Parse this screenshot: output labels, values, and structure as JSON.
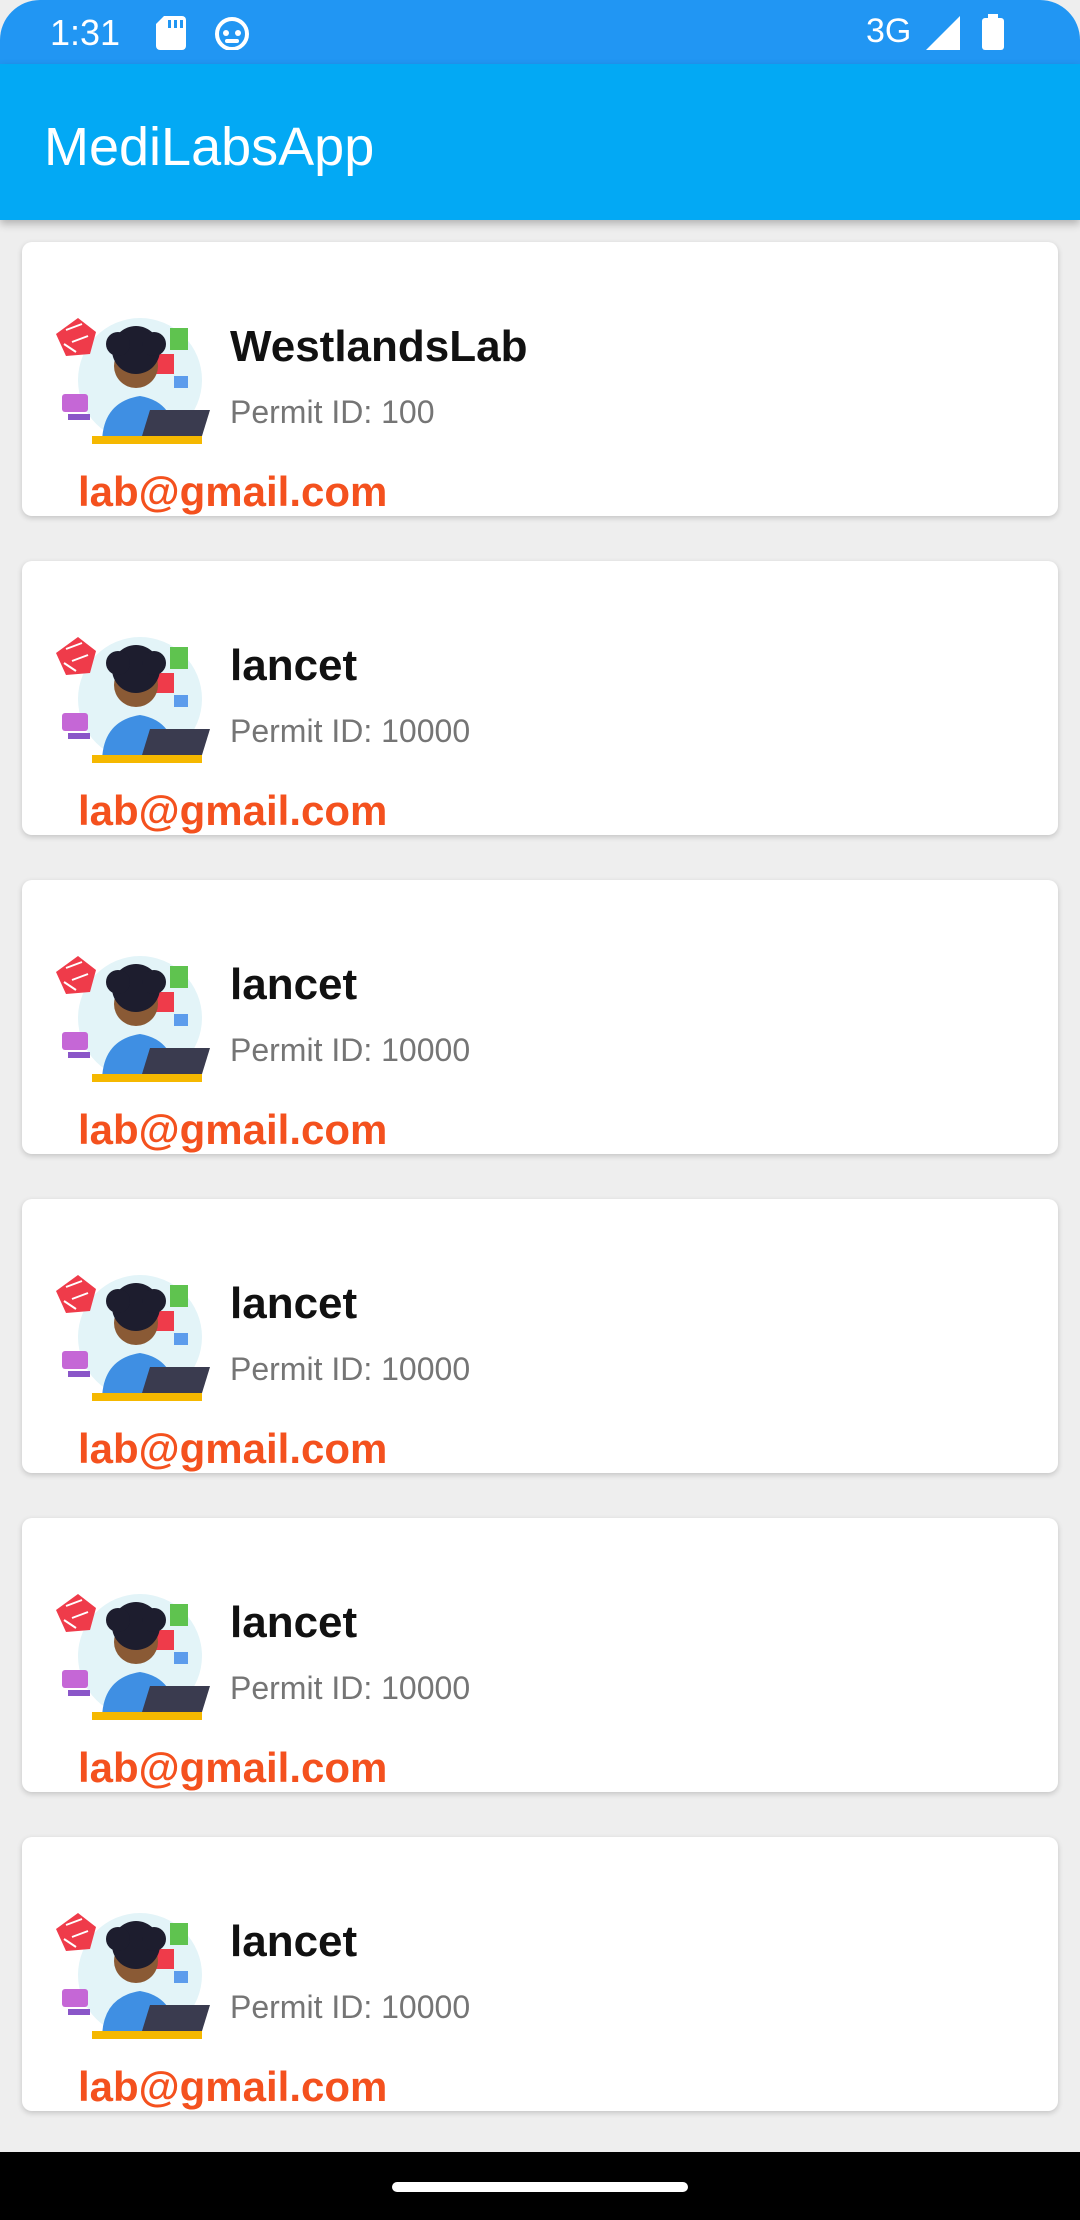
{
  "status_bar": {
    "time": "1:31",
    "network": "3G",
    "icons": [
      "sd-card-icon",
      "android-bot-icon",
      "signal-icon",
      "battery-icon"
    ]
  },
  "app_bar": {
    "title": "MediLabsApp"
  },
  "labs": [
    {
      "name": "WestlandsLab",
      "permit": "Permit ID: 100",
      "email": "lab@gmail.com"
    },
    {
      "name": "lancet",
      "permit": "Permit ID: 10000",
      "email": "lab@gmail.com"
    },
    {
      "name": "lancet",
      "permit": "Permit ID: 10000",
      "email": "lab@gmail.com"
    },
    {
      "name": "lancet",
      "permit": "Permit ID: 10000",
      "email": "lab@gmail.com"
    },
    {
      "name": "lancet",
      "permit": "Permit ID: 10000",
      "email": "lab@gmail.com"
    },
    {
      "name": "lancet",
      "permit": "Permit ID: 10000",
      "email": "lab@gmail.com"
    }
  ],
  "colors": {
    "status_bar": "#2196f3",
    "app_bar": "#03a9f4",
    "email": "#f4511e",
    "permit": "#757575"
  }
}
